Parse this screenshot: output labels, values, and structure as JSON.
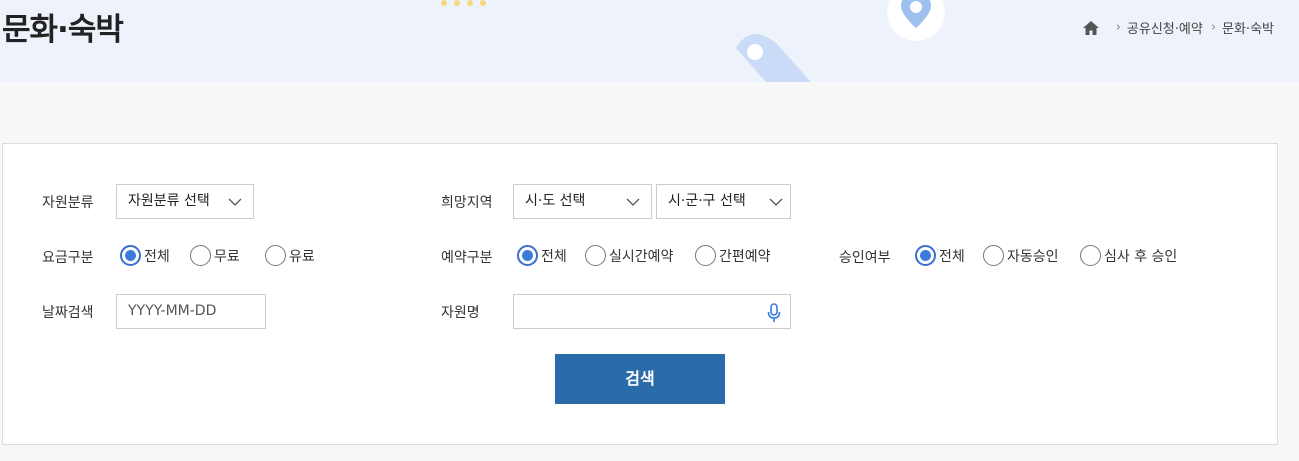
{
  "header": {
    "title": "문화·숙박",
    "breadcrumb": [
      "공유신청·예약",
      "문화·숙박"
    ]
  },
  "filters": {
    "resource_type": {
      "label": "자원분류",
      "value": "자원분류 선택"
    },
    "region": {
      "label": "희망지역",
      "province": "시·도 선택",
      "district": "시·군·구 선택"
    },
    "fee": {
      "label": "요금구분",
      "options": [
        "전체",
        "무료",
        "유료"
      ],
      "selected": "전체"
    },
    "reservation": {
      "label": "예약구분",
      "options": [
        "전체",
        "실시간예약",
        "간편예약"
      ],
      "selected": "전체"
    },
    "approval": {
      "label": "승인여부",
      "options": [
        "전체",
        "자동승인",
        "심사 후 승인"
      ],
      "selected": "전체"
    },
    "date": {
      "label": "날짜검색",
      "placeholder": "YYYY-MM-DD"
    },
    "resource_name": {
      "label": "자원명",
      "value": ""
    },
    "search_label": "검색"
  },
  "colors": {
    "accent": "#2a6ca9",
    "radio": "#3a7bdc",
    "banner": "#eef3fb"
  },
  "icons": [
    "home-icon",
    "chevron-down-icon",
    "microphone-icon",
    "location-pin-icon"
  ]
}
